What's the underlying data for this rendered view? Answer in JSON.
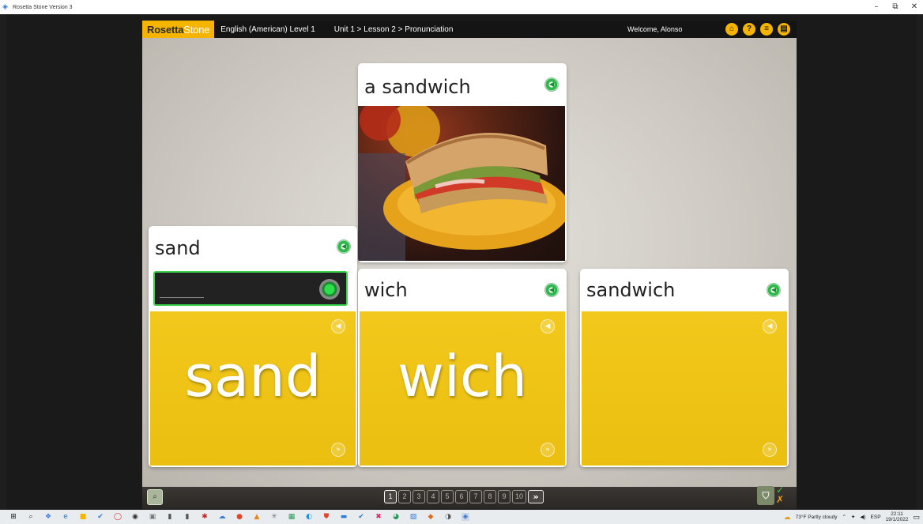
{
  "window": {
    "title": "Rosetta Stone Version 3",
    "minimize": "–",
    "restore": "⧉",
    "close": "✕"
  },
  "header": {
    "logo_bold": "Rosetta",
    "logo_light": "Stone",
    "course": "English (American) Level 1",
    "breadcrumb": "Unit 1 > Lesson 2 > Pronunciation",
    "welcome": "Welcome, Alonso",
    "icons": [
      "home-icon",
      "help-icon",
      "menu-icon",
      "chat-icon"
    ]
  },
  "cards": {
    "top": {
      "label": "a sandwich"
    },
    "left": {
      "label": "sand",
      "big": "sand"
    },
    "middle": {
      "label": "wich",
      "big": "wich"
    },
    "right": {
      "label": "sandwich",
      "big": ""
    }
  },
  "footer": {
    "pages": [
      "1",
      "2",
      "3",
      "4",
      "5",
      "6",
      "7",
      "8",
      "9",
      "10"
    ],
    "current_page": "1",
    "next": "»"
  },
  "taskbar": {
    "weather": "73°F  Partly cloudy",
    "lang": "ESP",
    "time": "22:11",
    "date": "19/1/2022"
  },
  "colors": {
    "accent": "#f4b400",
    "card_yellow": "#efc416",
    "mic_green": "#3bd14b"
  }
}
